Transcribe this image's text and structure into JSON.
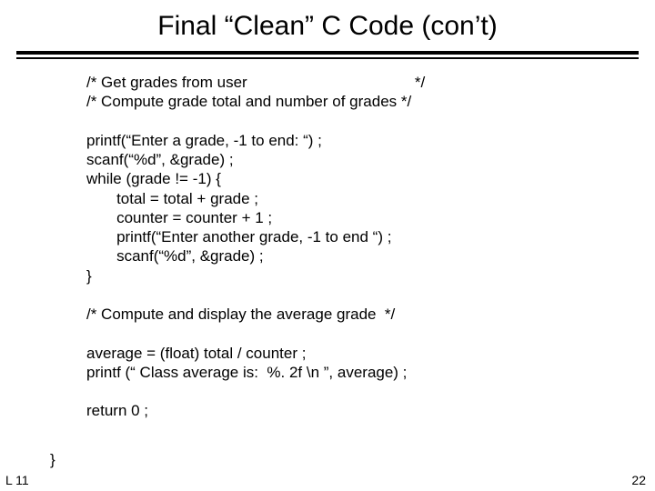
{
  "title": "Final “Clean” C Code (con’t)",
  "comment1a": "/* Get grades from user",
  "comment1b": "*/",
  "comment2": "/* Compute grade total and number of grades */",
  "line_printf1": "printf(“Enter a grade, -1 to end: “) ;",
  "line_scanf1": "scanf(“%d”, &grade) ;",
  "line_while": "while (grade != -1) {",
  "line_total": "total = total + grade ;",
  "line_counter": "counter = counter + 1 ;",
  "line_printf2": "printf(“Enter another grade, -1 to end “) ;",
  "line_scanf2": "scanf(“%d”, &grade) ;",
  "line_closebrace": "}",
  "comment3": "/* Compute and display the average grade  */",
  "line_average": "average = (float) total / counter ;",
  "line_printf3": "printf (“ Class average is:  %. 2f \\n ”, average) ;",
  "line_return": "return 0 ;",
  "outer_brace": "}",
  "footer_left": "L 11",
  "footer_right": "22"
}
